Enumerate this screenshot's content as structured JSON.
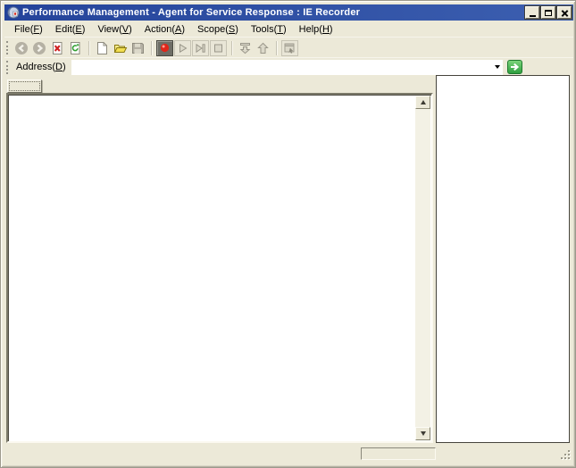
{
  "window": {
    "title": "Performance Management - Agent for Service Response : IE Recorder"
  },
  "menu": {
    "items": [
      {
        "pre": "File(",
        "key": "F",
        "post": ")"
      },
      {
        "pre": "Edit(",
        "key": "E",
        "post": ")"
      },
      {
        "pre": "View(",
        "key": "V",
        "post": ")"
      },
      {
        "pre": "Action(",
        "key": "A",
        "post": ")"
      },
      {
        "pre": "Scope(",
        "key": "S",
        "post": ")"
      },
      {
        "pre": "Tools(",
        "key": "T",
        "post": ")"
      },
      {
        "pre": "Help(",
        "key": "H",
        "post": ")"
      }
    ]
  },
  "toolbar": {
    "buttons": [
      {
        "name": "back",
        "enabled": false
      },
      {
        "name": "forward",
        "enabled": false
      },
      {
        "name": "stop-navigation",
        "enabled": true
      },
      {
        "name": "refresh",
        "enabled": true
      },
      {
        "name": "new-document",
        "enabled": true
      },
      {
        "name": "open",
        "enabled": true
      },
      {
        "name": "save",
        "enabled": false
      },
      {
        "name": "record",
        "enabled": true,
        "active": true
      },
      {
        "name": "play",
        "enabled": false
      },
      {
        "name": "step",
        "enabled": false
      },
      {
        "name": "stop-recording",
        "enabled": false
      },
      {
        "name": "move-down",
        "enabled": false
      },
      {
        "name": "move-up",
        "enabled": false
      },
      {
        "name": "capture",
        "enabled": false
      }
    ]
  },
  "address": {
    "label_pre": "Address(",
    "label_key": "D",
    "label_post": ")",
    "value": ""
  },
  "main": {
    "tab_label": "",
    "content": ""
  },
  "side_panel": {
    "content": ""
  },
  "status": {
    "field": ""
  },
  "colors": {
    "titlebar_blue": "#2b4ea6",
    "chrome_beige": "#ece9d8",
    "record_red": "#e0261a",
    "go_green": "#2f9e3f",
    "folder_yellow": "#f2df52"
  }
}
